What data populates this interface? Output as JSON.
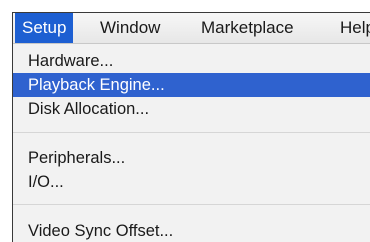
{
  "menubar": {
    "items": [
      {
        "label": "Setup",
        "active": true
      },
      {
        "label": "Window",
        "active": false
      },
      {
        "label": "Marketplace",
        "active": false
      },
      {
        "label": "Help",
        "active": false
      }
    ]
  },
  "setup_menu": {
    "items": [
      {
        "label": "Hardware...",
        "selected": false
      },
      {
        "label": "Playback Engine...",
        "selected": true
      },
      {
        "label": "Disk Allocation...",
        "selected": false
      },
      {
        "label": "Peripherals...",
        "selected": false
      },
      {
        "label": "I/O...",
        "selected": false
      },
      {
        "label": "Video Sync Offset...",
        "selected": false
      }
    ]
  },
  "colors": {
    "selection": "#2f62cf",
    "active_menu": "#1d5fd2",
    "menu_background": "#f2f2f2"
  }
}
